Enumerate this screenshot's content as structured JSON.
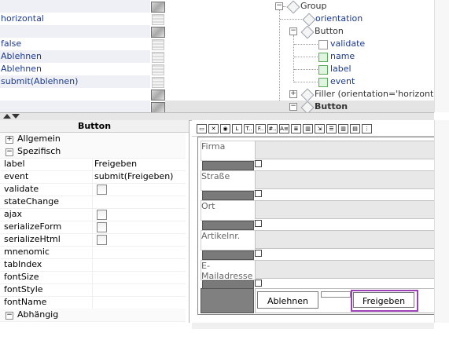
{
  "top": {
    "values": [
      {
        "text": "",
        "shade": true,
        "btn": "img"
      },
      {
        "text": "horizontal",
        "shade": false,
        "btn": "lines"
      },
      {
        "text": "",
        "shade": true,
        "btn": "img"
      },
      {
        "text": "false",
        "shade": false,
        "btn": "lines"
      },
      {
        "text": "Ablehnen",
        "shade": true,
        "btn": "lines"
      },
      {
        "text": "Ablehnen",
        "shade": false,
        "btn": "lines"
      },
      {
        "text": "submit(Ablehnen)",
        "shade": true,
        "btn": "lines"
      },
      {
        "text": "",
        "shade": false,
        "btn": "img"
      },
      {
        "text": "",
        "shade": true,
        "btn": "img"
      }
    ],
    "tree": {
      "group": "Group",
      "orientation": "orientation",
      "button1": "Button",
      "validate": "validate",
      "name": "name",
      "label": "label",
      "event": "event",
      "filler": "Filler (orientation='horizontal' s",
      "button2": "Button"
    }
  },
  "props": {
    "title": "Button",
    "rows": [
      {
        "name": "Allgemein",
        "type": "section",
        "expander": "+"
      },
      {
        "name": "Spezifisch",
        "type": "section",
        "expander": "−"
      },
      {
        "name": "label",
        "value": "Freigeben"
      },
      {
        "name": "event",
        "value": "submit(Freigeben)"
      },
      {
        "name": "validate",
        "check": true
      },
      {
        "name": "stateChange"
      },
      {
        "name": "ajax",
        "check": true
      },
      {
        "name": "serializeForm",
        "check": true
      },
      {
        "name": "serializeHtml",
        "check": true
      },
      {
        "name": "mnenomic"
      },
      {
        "name": "tabIndex"
      },
      {
        "name": "fontSize"
      },
      {
        "name": "fontStyle"
      },
      {
        "name": "fontName"
      },
      {
        "name": "Abhängig",
        "type": "section",
        "expander": "−"
      }
    ]
  },
  "toolbar": {
    "icons": [
      "textfield-icon",
      "checkbox-icon",
      "radio-icon",
      "label-icon",
      "textarea-icon",
      "date-field-icon",
      "number-field-icon",
      "image-icon",
      "table-icon",
      "grid-icon",
      "button-icon",
      "list-icon",
      "columns-icon",
      "rows-icon",
      "tree-icon"
    ],
    "glyphs": [
      "▭",
      "✕",
      "◉",
      "L",
      "T..",
      "F..",
      "#..",
      "A≡",
      "≣",
      "▥",
      "⇲",
      "☰",
      "▥",
      "▤",
      "⋮"
    ]
  },
  "form": {
    "fields": [
      {
        "label": "Firma"
      },
      {
        "label": "Straße"
      },
      {
        "label": "Ort"
      },
      {
        "label": "Artikelnr."
      },
      {
        "label": "E-Mailadresse"
      }
    ],
    "buttons": {
      "reject": "Ablehnen",
      "approve": "Freigeben"
    },
    "colors": {
      "selected_border": "#9b3fb5",
      "value_text": "#1b3a8c"
    }
  }
}
